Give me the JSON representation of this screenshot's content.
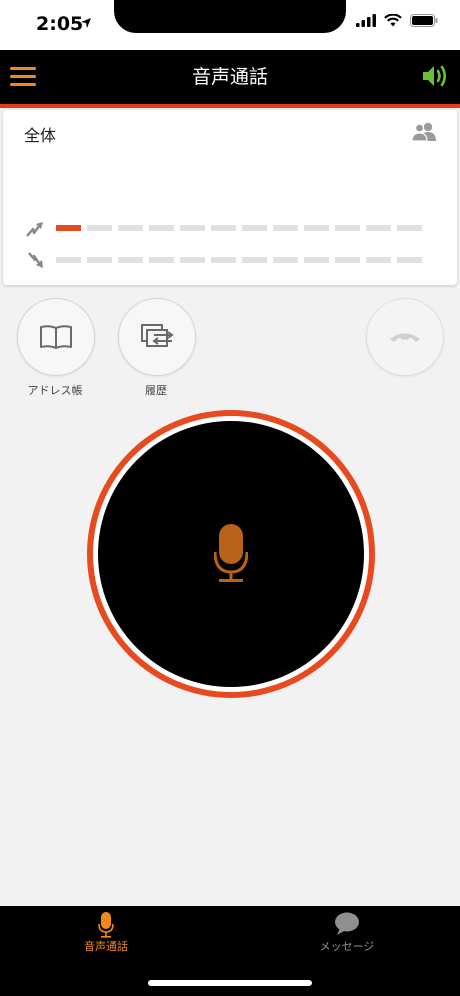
{
  "status": {
    "time": "2:05"
  },
  "header": {
    "title": "音声通話"
  },
  "group": {
    "name": "全体",
    "uplink_level": 1,
    "downlink_level": 0,
    "segments": 12
  },
  "actions": {
    "address_book": "アドレス帳",
    "history": "履歴"
  },
  "tabs": [
    {
      "label": "音声通話",
      "active": true
    },
    {
      "label": "メッセージ",
      "active": false
    }
  ],
  "colors": {
    "accent": "#f08a1c",
    "red": "#e84a1f",
    "speaker": "#6abf3a",
    "mic": "#b8621a"
  },
  "icons": [
    "menu-icon",
    "speaker-icon",
    "group-icon",
    "uplink-icon",
    "downlink-icon",
    "book-icon",
    "history-icon",
    "hangup-icon",
    "microphone-icon",
    "chat-bubble-icon"
  ]
}
